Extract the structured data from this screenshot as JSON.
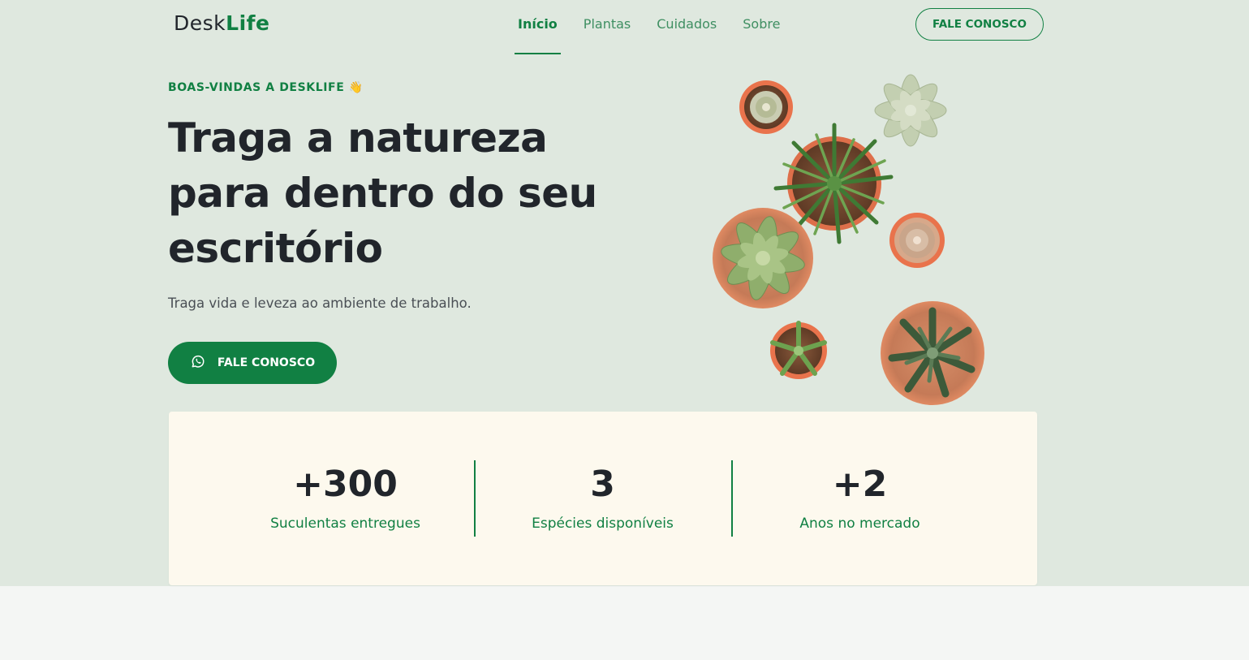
{
  "brand": {
    "name_part1": "Desk",
    "name_part2": "Life",
    "accent_color": "#118043"
  },
  "nav": {
    "items": [
      {
        "label": "Início",
        "active": true
      },
      {
        "label": "Plantas",
        "active": false
      },
      {
        "label": "Cuidados",
        "active": false
      },
      {
        "label": "Sobre",
        "active": false
      }
    ],
    "cta_label": "FALE CONOSCO"
  },
  "hero": {
    "eyebrow": "BOAS-VINDAS A DESKLIFE 👋",
    "title": "Traga a natureza para dentro do seu escritório",
    "subtitle": "Traga vida e leveza ao ambiente de trabalho.",
    "cta_label": "FALE CONOSCO",
    "cta_icon": "whatsapp-icon"
  },
  "stats": [
    {
      "value": "+300",
      "label": "Suculentas entregues"
    },
    {
      "value": "3",
      "label": "Espécies disponíveis"
    },
    {
      "value": "+2",
      "label": "Anos no mercado"
    }
  ],
  "colors": {
    "hero_background": "#dfe8df",
    "page_background": "#f4f6f4",
    "stats_background": "#fdf9ee",
    "text_dark": "#21252b"
  }
}
